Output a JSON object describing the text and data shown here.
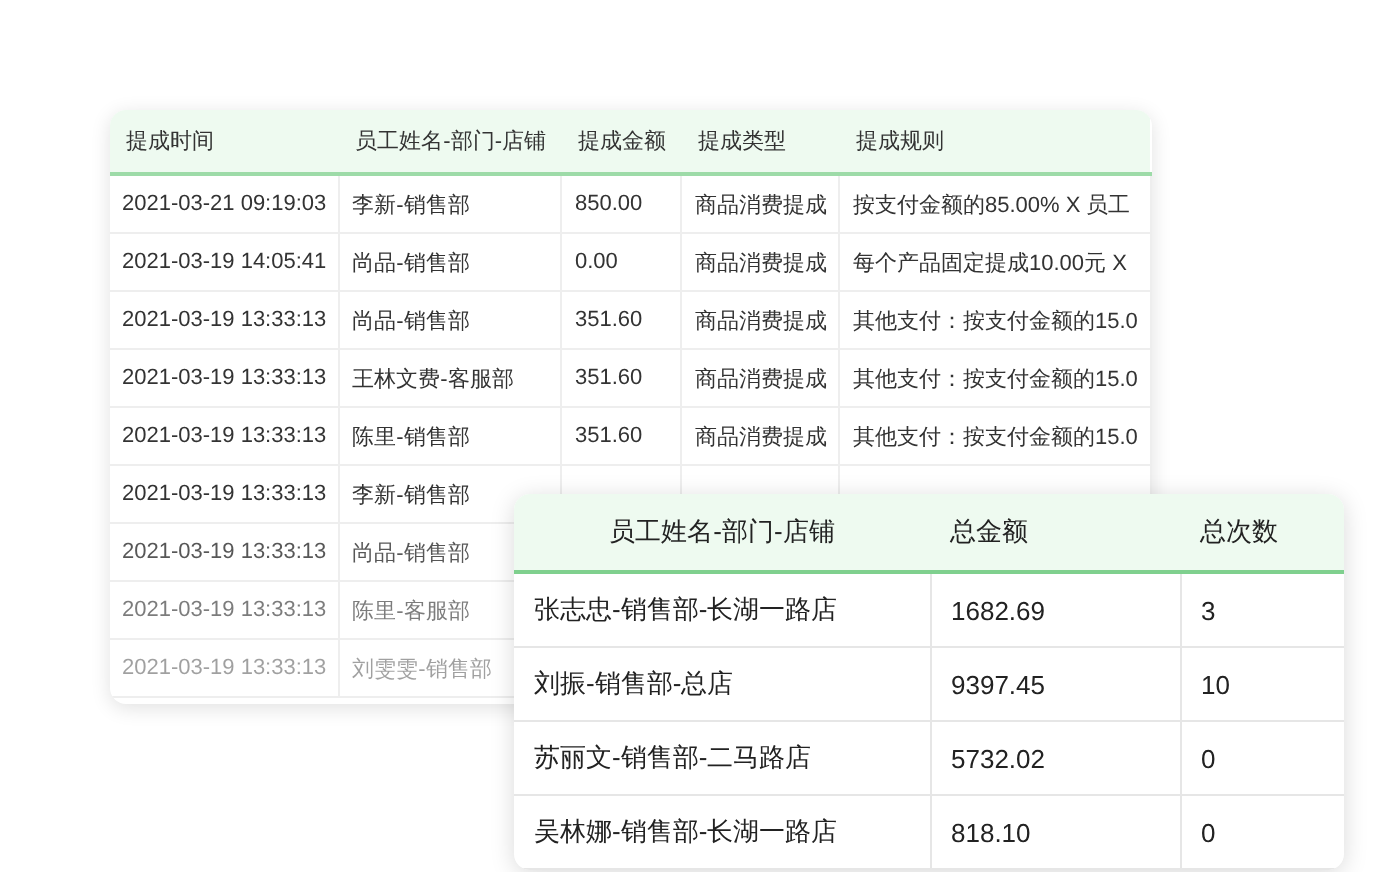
{
  "commission_table": {
    "columns": [
      "提成时间",
      "员工姓名-部门-店铺",
      "提成金额",
      "提成类型",
      "提成规则"
    ],
    "rows": [
      {
        "cells": [
          "2021-03-21 09:19:03",
          "李新-销售部",
          "850.00",
          "商品消费提成",
          "按支付金额的85.00% X 员工"
        ]
      },
      {
        "cells": [
          "2021-03-19 14:05:41",
          "尚品-销售部",
          "0.00",
          "商品消费提成",
          "每个产品固定提成10.00元 X"
        ]
      },
      {
        "cells": [
          "2021-03-19 13:33:13",
          "尚品-销售部",
          "351.60",
          "商品消费提成",
          "其他支付：按支付金额的15.0"
        ]
      },
      {
        "cells": [
          "2021-03-19 13:33:13",
          "王林文费-客服部",
          "351.60",
          "商品消费提成",
          "其他支付：按支付金额的15.0"
        ]
      },
      {
        "cells": [
          "2021-03-19 13:33:13",
          "陈里-销售部",
          "351.60",
          "商品消费提成",
          "其他支付：按支付金额的15.0"
        ]
      },
      {
        "cells": [
          "2021-03-19 13:33:13",
          "李新-销售部"
        ]
      },
      {
        "cells": [
          "2021-03-19 13:33:13",
          "尚品-销售部"
        ]
      },
      {
        "cells": [
          "2021-03-19 13:33:13",
          "陈里-客服部"
        ]
      },
      {
        "cells": [
          "2021-03-19 13:33:13",
          "刘雯雯-销售部"
        ]
      }
    ]
  },
  "summary_table": {
    "columns": [
      "员工姓名-部门-店铺",
      "总金额",
      "总次数"
    ],
    "rows": [
      {
        "cells": [
          "张志忠-销售部-长湖一路店",
          "1682.69",
          "3"
        ]
      },
      {
        "cells": [
          "刘振-销售部-总店",
          "9397.45",
          "10"
        ]
      },
      {
        "cells": [
          "苏丽文-销售部-二马路店",
          "5732.02",
          "0"
        ]
      },
      {
        "cells": [
          "吴林娜-销售部-长湖一路店",
          "818.10",
          "0"
        ]
      }
    ]
  }
}
